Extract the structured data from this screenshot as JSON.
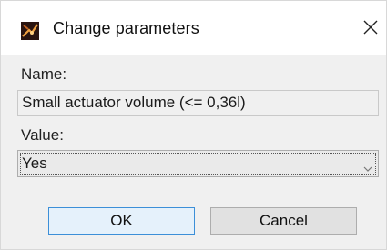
{
  "window": {
    "title": "Change parameters",
    "icon": "app-logo-icon",
    "close_icon": "close-icon"
  },
  "form": {
    "name_label": "Name:",
    "name_value": "Small actuator volume (<= 0,36l)",
    "value_label": "Value:",
    "value_selected": "Yes",
    "dropdown_icon": "chevron-down-icon"
  },
  "buttons": {
    "ok_label": "OK",
    "cancel_label": "Cancel"
  },
  "colors": {
    "content_bg": "#f0f0f0",
    "ok_border": "#3c8fd8",
    "ok_bg": "#e5f1fb"
  }
}
